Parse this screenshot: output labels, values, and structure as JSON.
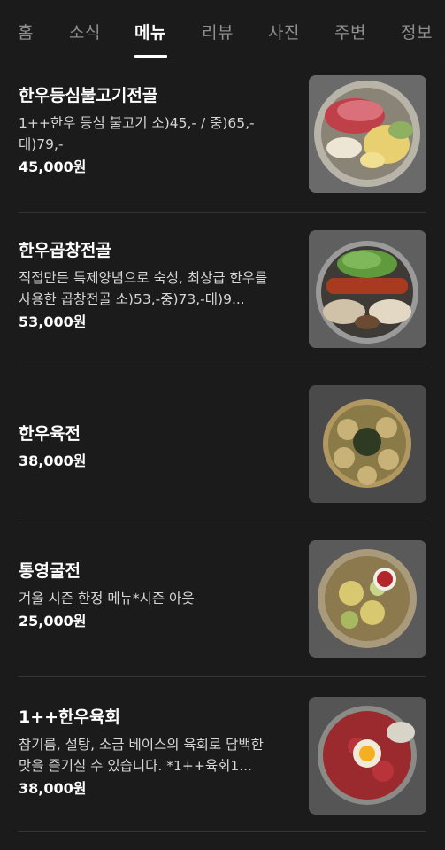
{
  "tabs": [
    {
      "label": "홈"
    },
    {
      "label": "소식"
    },
    {
      "label": "메뉴"
    },
    {
      "label": "리뷰"
    },
    {
      "label": "사진"
    },
    {
      "label": "주변"
    },
    {
      "label": "정보"
    }
  ],
  "active_tab": "메뉴",
  "menu": [
    {
      "name": "한우등심불고기전골",
      "description": "1++한우 등심 불고기 소)45,- / 중)65,-대)79,-",
      "price": "45,000원",
      "photo_icon": "bulgogi-hotpot-photo"
    },
    {
      "name": "한우곱창전골",
      "description": "직접만든 특제양념으로 숙성, 최상급 한우를 사용한 곱창전골 소)53,-중)73,-대)9...",
      "price": "53,000원",
      "photo_icon": "gopchang-hotpot-photo"
    },
    {
      "name": "한우육전",
      "description": "",
      "price": "38,000원",
      "photo_icon": "yukjeon-photo"
    },
    {
      "name": "통영굴전",
      "description": "겨울 시즌 한정 메뉴*시즌 아웃",
      "price": "25,000원",
      "photo_icon": "oyster-pancake-photo"
    },
    {
      "name": "1++한우육회",
      "description": "참기름, 설탕, 소금 베이스의 육회로 담백한 맛을 즐기실 수 있습니다. *1++육회1...",
      "price": "38,000원",
      "photo_icon": "yukhoe-photo"
    }
  ]
}
